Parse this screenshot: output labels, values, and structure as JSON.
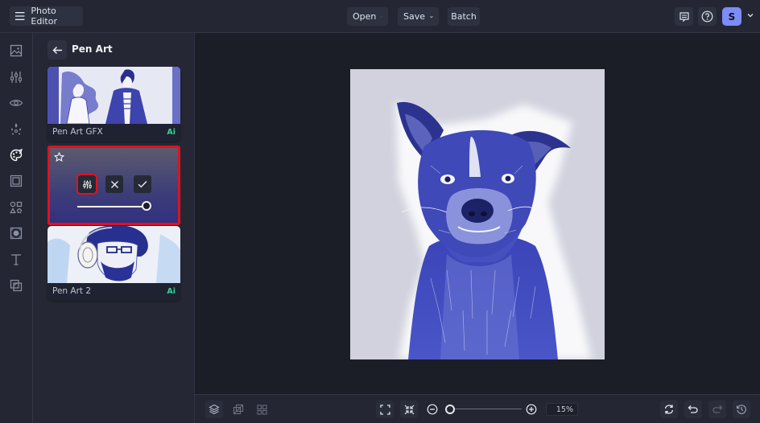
{
  "app": {
    "title": "Photo Editor"
  },
  "topbar": {
    "menus": [
      {
        "label": "Open",
        "has_dropdown": true
      },
      {
        "label": "Save",
        "has_dropdown": true
      },
      {
        "label": "Batch",
        "has_dropdown": false
      }
    ],
    "icons": [
      "feedback-icon",
      "help-icon"
    ],
    "avatar_initial": "S",
    "avatar_color": "#7c8cf8"
  },
  "left_rail": {
    "items": [
      {
        "icon": "image-icon",
        "active": false
      },
      {
        "icon": "adjust-sliders-icon",
        "active": false
      },
      {
        "icon": "eye-icon",
        "active": false
      },
      {
        "icon": "sparkle-effects-icon",
        "active": false
      },
      {
        "icon": "palette-artsy-icon",
        "active": true
      },
      {
        "icon": "frame-icon",
        "active": false
      },
      {
        "icon": "shapes-graphics-icon",
        "active": false
      },
      {
        "icon": "texture-icon",
        "active": false
      },
      {
        "icon": "text-icon",
        "active": false
      },
      {
        "icon": "overlay-icon",
        "active": false
      }
    ]
  },
  "panel": {
    "title": "Pen Art",
    "cards": [
      {
        "name": "Pen Art GFX",
        "badge": "Ai"
      },
      {
        "name": "Pen Art 2",
        "badge": "Ai"
      }
    ],
    "active_effect": {
      "intensity": 1.0,
      "controls": [
        "settings",
        "cancel",
        "apply"
      ]
    }
  },
  "bottombar": {
    "zoom_level": "15%",
    "zoom_slider_fraction": 0.0
  },
  "colors": {
    "highlight": "#e0121e",
    "ai_badge": "#34d399"
  }
}
